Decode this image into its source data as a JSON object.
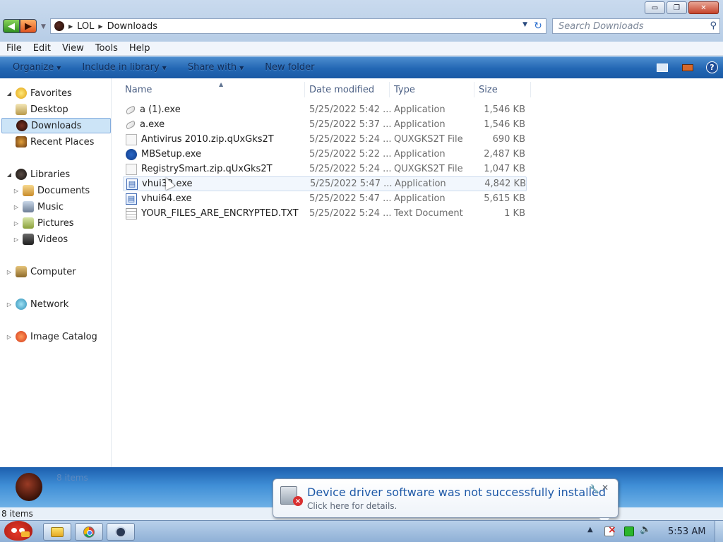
{
  "window": {
    "minimize": "▭",
    "maximize": "❐",
    "close": "✕"
  },
  "address": {
    "crumbs": [
      "LOL",
      "Downloads"
    ]
  },
  "search": {
    "placeholder": "Search Downloads"
  },
  "menu": [
    "File",
    "Edit",
    "View",
    "Tools",
    "Help"
  ],
  "commands": {
    "organize": "Organize",
    "include_in_library": "Include in library",
    "share_with": "Share with",
    "new_folder": "New folder"
  },
  "navigation": {
    "favorites": "Favorites",
    "desktop": "Desktop",
    "downloads": "Downloads",
    "recent_places": "Recent Places",
    "libraries": "Libraries",
    "documents": "Documents",
    "music": "Music",
    "pictures": "Pictures",
    "videos": "Videos",
    "computer": "Computer",
    "network": "Network",
    "image_catalog": "Image Catalog"
  },
  "columns": {
    "name": "Name",
    "date_modified": "Date modified",
    "type": "Type",
    "size": "Size"
  },
  "files": [
    {
      "name": "a (1).exe",
      "date": "5/25/2022 5:42 ...",
      "type": "Application",
      "size": "1,546 KB",
      "icon": "app-icon"
    },
    {
      "name": "a.exe",
      "date": "5/25/2022 5:37 ...",
      "type": "Application",
      "size": "1,546 KB",
      "icon": "app-icon"
    },
    {
      "name": "Antivirus 2010.zip.qUxGks2T",
      "date": "5/25/2022 5:24 ...",
      "type": "QUXGKS2T File",
      "size": "690 KB",
      "icon": "file-icon"
    },
    {
      "name": "MBSetup.exe",
      "date": "5/25/2022 5:22 ...",
      "type": "Application",
      "size": "2,487 KB",
      "icon": "malwarebytes-icon"
    },
    {
      "name": "RegistrySmart.zip.qUxGks2T",
      "date": "5/25/2022 5:24 ...",
      "type": "QUXGKS2T File",
      "size": "1,047 KB",
      "icon": "file-icon"
    },
    {
      "name": "vhui32.exe",
      "date": "5/25/2022 5:47 ...",
      "type": "Application",
      "size": "4,842 KB",
      "icon": "window-app-icon"
    },
    {
      "name": "vhui64.exe",
      "date": "5/25/2022 5:47 ...",
      "type": "Application",
      "size": "5,615 KB",
      "icon": "window-app-icon"
    },
    {
      "name": "YOUR_FILES_ARE_ENCRYPTED.TXT",
      "date": "5/25/2022 5:24 ...",
      "type": "Text Document",
      "size": "1 KB",
      "icon": "text-document-icon"
    }
  ],
  "details": {
    "count": "8 items"
  },
  "status": {
    "text": "8 items"
  },
  "notification": {
    "title": "Device driver software was not successfully installed",
    "subtitle": "Click here for details."
  },
  "clock": "5:53 AM",
  "colors": {
    "command_bar": "#2367b4",
    "selection": "#cce4f7",
    "notification_title": "#1f5aa8"
  }
}
